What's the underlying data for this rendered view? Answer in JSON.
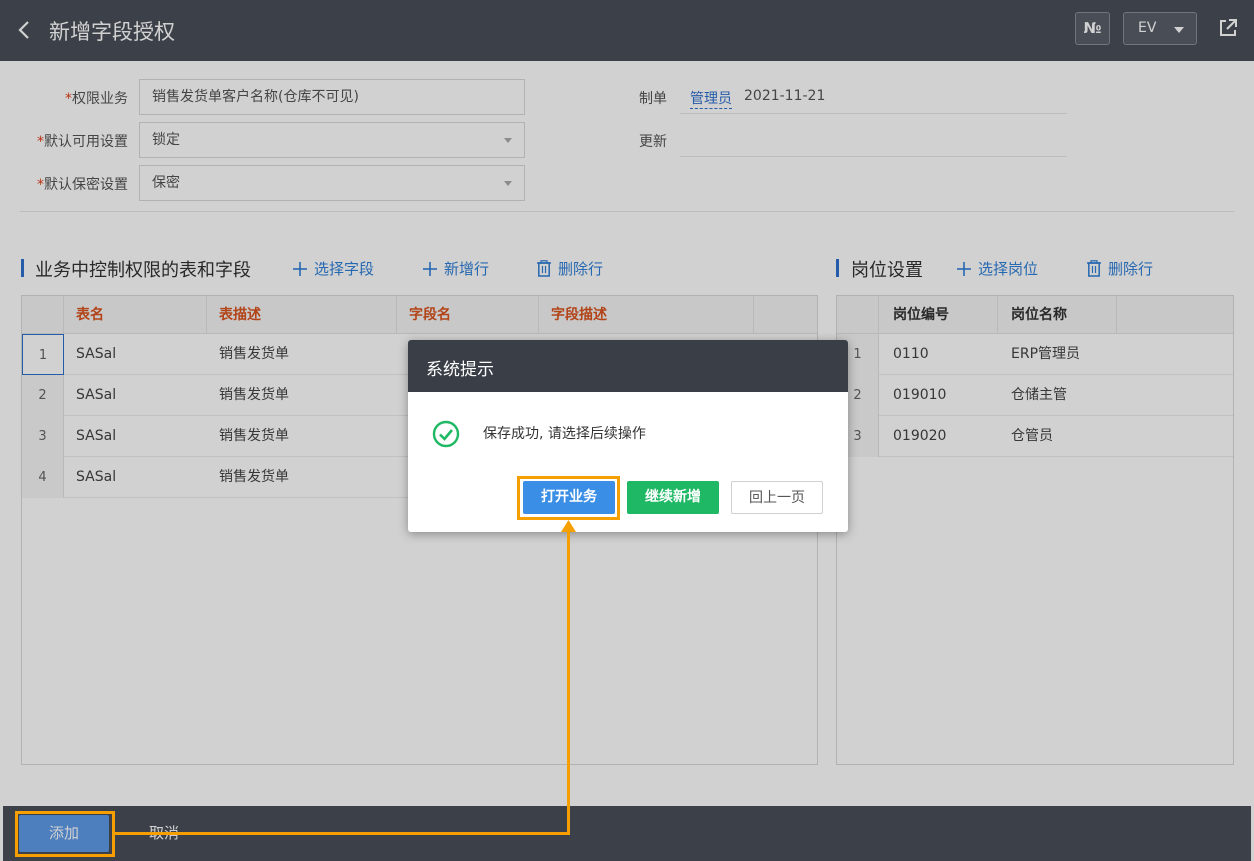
{
  "header": {
    "title": "新增字段授权",
    "no_label": "№",
    "lang_label": "EV"
  },
  "form": {
    "permission_business": {
      "label": "权限业务",
      "value": "销售发货单客户名称(仓库不可见)"
    },
    "default_available": {
      "label": "默认可用设置",
      "value": "锁定"
    },
    "default_secret": {
      "label": "默认保密设置",
      "value": "保密"
    },
    "maker": {
      "label": "制单",
      "user": "管理员",
      "date": "2021-11-21"
    },
    "updated": {
      "label": "更新",
      "value": ""
    }
  },
  "left_section": {
    "title": "业务中控制权限的表和字段",
    "tools": {
      "select_field": "选择字段",
      "add_row": "新增行",
      "delete_row": "删除行"
    },
    "columns": [
      "表名",
      "表描述",
      "字段名",
      "字段描述"
    ],
    "rows": [
      {
        "num": "1",
        "table": "SASal",
        "desc": "销售发货单"
      },
      {
        "num": "2",
        "table": "SASal",
        "desc": "销售发货单"
      },
      {
        "num": "3",
        "table": "SASal",
        "desc": "销售发货单"
      },
      {
        "num": "4",
        "table": "SASal",
        "desc": "销售发货单"
      }
    ]
  },
  "right_section": {
    "title": "岗位设置",
    "tools": {
      "select_post": "选择岗位",
      "delete_row": "删除行"
    },
    "columns": [
      "岗位编号",
      "岗位名称"
    ],
    "rows": [
      {
        "num": "1",
        "code": "0110",
        "name": "ERP管理员"
      },
      {
        "num": "2",
        "code": "019010",
        "name": "仓储主管"
      },
      {
        "num": "3",
        "code": "019020",
        "name": "仓管员"
      }
    ]
  },
  "footer": {
    "add_label": "添加",
    "cancel_label": "取消"
  },
  "dialog": {
    "title": "系统提示",
    "message": "保存成功, 请选择后续操作",
    "open_label": "打开业务",
    "continue_label": "继续新增",
    "back_label": "回上一页"
  },
  "colors": {
    "accent": "#2f7fd8",
    "header_bg": "#4a5059",
    "column_header_text": "#d9531e",
    "success": "#1fb865",
    "annotation": "#f5a000"
  }
}
